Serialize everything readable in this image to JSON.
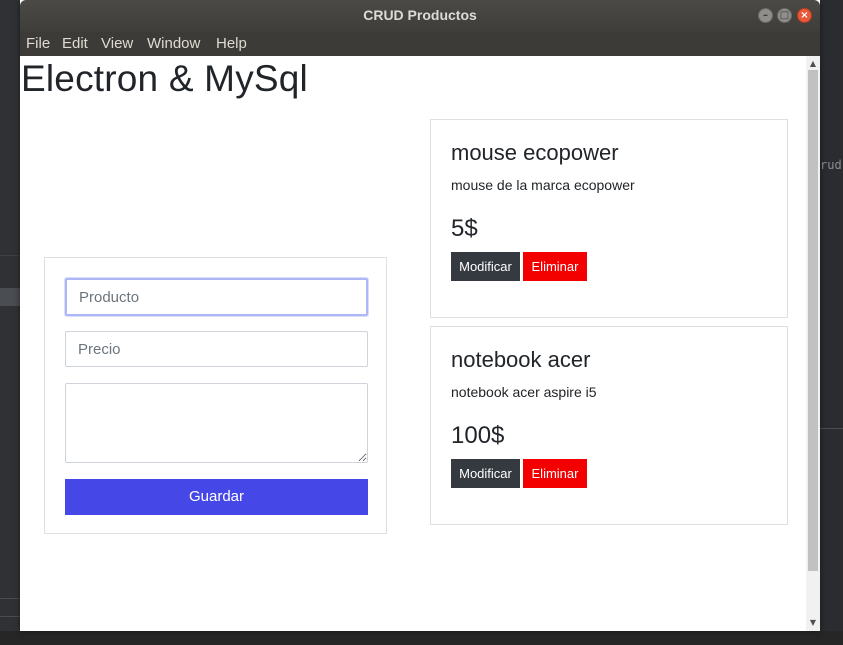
{
  "window": {
    "title": "CRUD Productos",
    "controls": {
      "minimize": "–",
      "maximize": "□",
      "close": "×"
    }
  },
  "menu": [
    "File",
    "Edit",
    "View",
    "Window",
    "Help"
  ],
  "page": {
    "title": "Electron & MySql"
  },
  "form": {
    "producto_placeholder": "Producto",
    "precio_placeholder": "Precio",
    "descripcion_value": "",
    "submit_label": "Guardar"
  },
  "products": [
    {
      "name": "mouse ecopower",
      "description": "mouse de la marca ecopower",
      "price": "5$",
      "modify_label": "Modificar",
      "delete_label": "Eliminar"
    },
    {
      "name": "notebook acer",
      "description": "notebook acer aspire i5",
      "price": "100$",
      "modify_label": "Modificar",
      "delete_label": "Eliminar"
    }
  ],
  "background": {
    "side_text": "rud"
  },
  "colors": {
    "primary_button": "#4548e6",
    "modify_button": "#343a40",
    "delete_button": "#f30000",
    "titlebar": "#3e3d39"
  }
}
